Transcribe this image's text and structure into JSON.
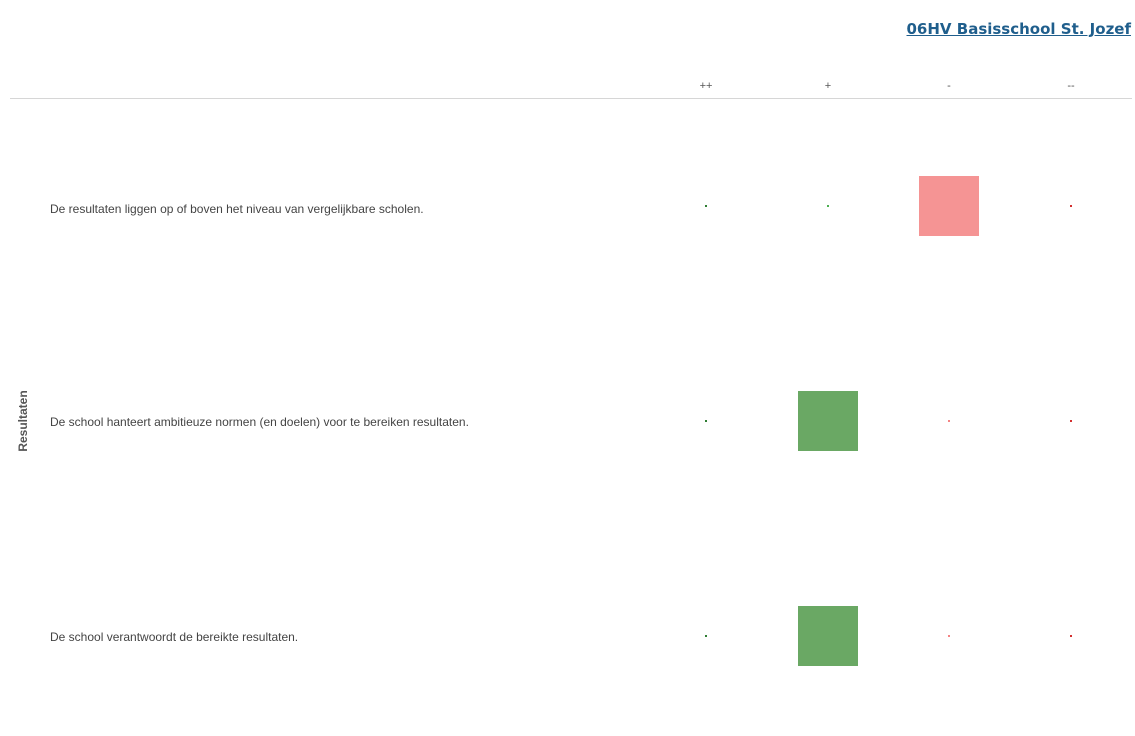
{
  "header": {
    "school_link": "06HV Basisschool St. Jozef"
  },
  "chart_data": {
    "type": "heatmap",
    "title": "",
    "group_label": "Resultaten",
    "columns": [
      "++",
      "+",
      "-",
      "--"
    ],
    "column_colors": [
      "#2e7d32",
      "#4caf50",
      "#f48484",
      "#d32f2f"
    ],
    "filled_colors": [
      "#2e7d32",
      "#6aa864",
      "#f59494",
      "#d32f2f"
    ],
    "rows": [
      {
        "label": "De resultaten liggen op of boven het niveau van vergelijkbare scholen.",
        "values": [
          0,
          0,
          1,
          0
        ]
      },
      {
        "label": "De school hanteert ambitieuze normen (en doelen) voor te bereiken resultaten.",
        "values": [
          0,
          1,
          0,
          0
        ]
      },
      {
        "label": "De school verantwoordt de bereikte resultaten.",
        "values": [
          0,
          1,
          0,
          0
        ]
      }
    ]
  }
}
